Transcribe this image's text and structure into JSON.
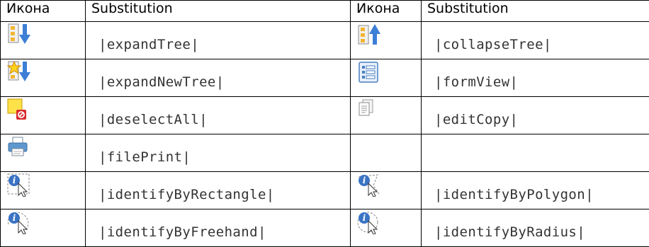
{
  "headers": [
    "Икона",
    "Substitution",
    "Икона",
    "Substitution"
  ],
  "rows": [
    {
      "left": {
        "icon": "expand-tree-icon",
        "text": "|expandTree|"
      },
      "right": {
        "icon": "collapse-tree-icon",
        "text": "|collapseTree|"
      }
    },
    {
      "left": {
        "icon": "expand-new-tree-icon",
        "text": "|expandNewTree|"
      },
      "right": {
        "icon": "form-view-icon",
        "text": "|formView|"
      }
    },
    {
      "left": {
        "icon": "deselect-all-icon",
        "text": "|deselectAll|"
      },
      "right": {
        "icon": "edit-copy-icon",
        "text": "|editCopy|"
      }
    },
    {
      "left": {
        "icon": "file-print-icon",
        "text": "|filePrint|"
      },
      "right": {
        "icon": "",
        "text": ""
      }
    },
    {
      "left": {
        "icon": "identify-by-rectangle-icon",
        "text": "|identifyByRectangle|"
      },
      "right": {
        "icon": "identify-by-polygon-icon",
        "text": "|identifyByPolygon|"
      }
    },
    {
      "left": {
        "icon": "identify-by-freehand-icon",
        "text": "|identifyByFreehand|"
      },
      "right": {
        "icon": "identify-by-radius-icon",
        "text": "|identifyByRadius|"
      }
    }
  ]
}
